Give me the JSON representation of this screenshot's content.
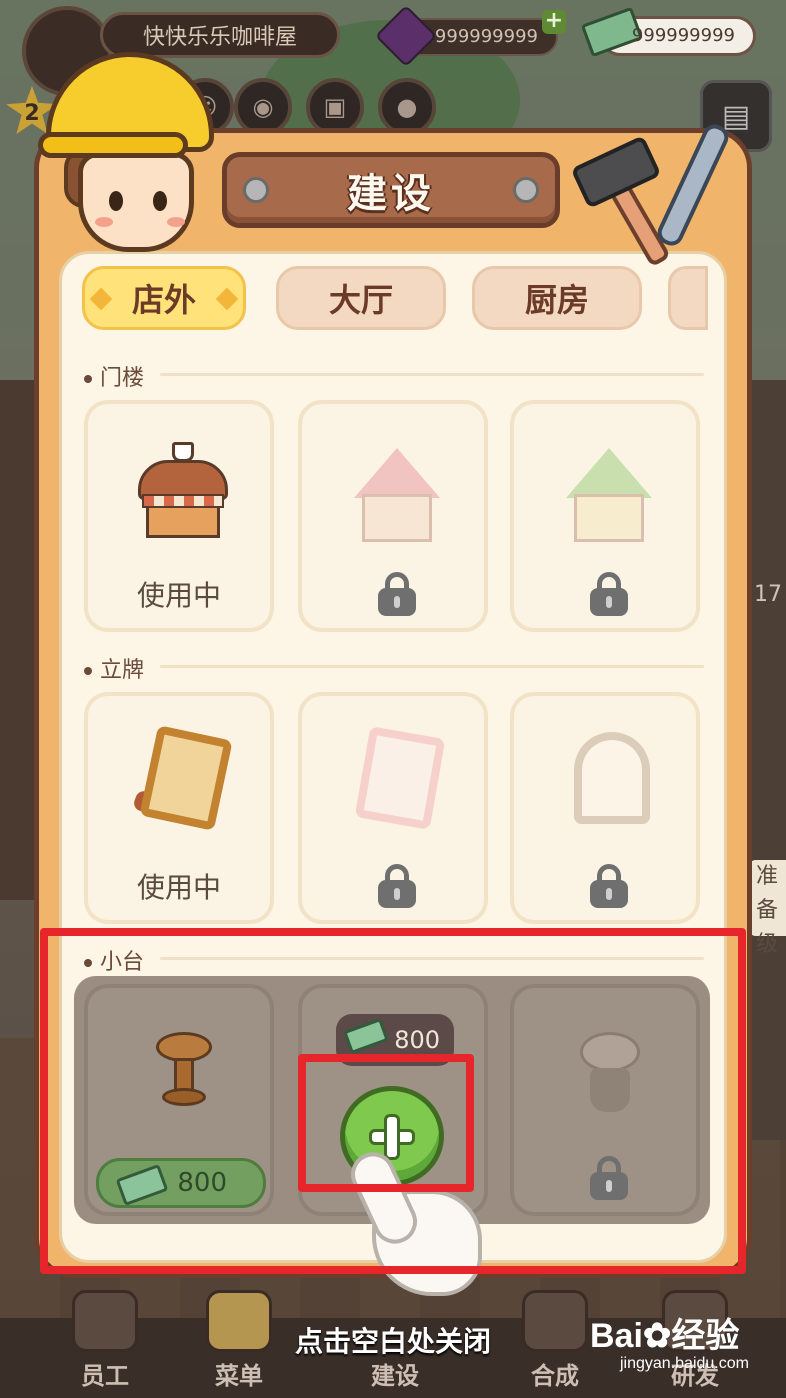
{
  "hud": {
    "shop_name": "快快乐乐咖啡屋",
    "level": "2",
    "gems": "999999999",
    "cash": "999999999",
    "plus": "+"
  },
  "dialog": {
    "title": "建设",
    "tabs": [
      {
        "label": "店外",
        "active": true
      },
      {
        "label": "大厅",
        "active": false
      },
      {
        "label": "厨房",
        "active": false
      }
    ],
    "sections": [
      {
        "label": "门楼",
        "items": [
          {
            "icon": "coffee-shop-facade-icon",
            "status": "使用中",
            "locked": false
          },
          {
            "icon": "pink-house-facade-icon",
            "status": "",
            "locked": true
          },
          {
            "icon": "green-house-facade-icon",
            "status": "",
            "locked": true
          }
        ]
      },
      {
        "label": "立牌",
        "items": [
          {
            "icon": "cafe-signboard-icon",
            "status": "使用中",
            "locked": false
          },
          {
            "icon": "pink-signboard-icon",
            "status": "",
            "locked": true
          },
          {
            "icon": "cream-signboard-icon",
            "status": "",
            "locked": true
          }
        ]
      },
      {
        "label": "小台",
        "items": [
          {
            "icon": "wooden-stand-icon",
            "price": "800",
            "locked": false
          },
          {
            "icon": "add-icon",
            "price": "800",
            "locked": false
          },
          {
            "icon": "round-stand-icon",
            "locked": true
          }
        ]
      }
    ],
    "close_hint": "点击空白处关闭"
  },
  "nav": [
    {
      "label": "员工"
    },
    {
      "label": "菜单"
    },
    {
      "label": "建设"
    },
    {
      "label": "合成"
    },
    {
      "label": "研发"
    }
  ],
  "side": {
    "badge": "准备级",
    "number": "17"
  },
  "watermark": {
    "main": "Bai",
    "cn": "经验",
    "sub": "jingyan.baidu.com"
  },
  "colors": {
    "panel": "#f0b46a",
    "highlight": "#e6262a",
    "add_button": "#7fc94f",
    "active_tab": "#ffe37a"
  }
}
